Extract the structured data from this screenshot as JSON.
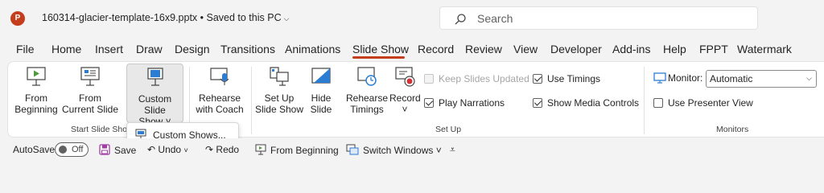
{
  "app": {
    "logo_letter": "P",
    "doc_title": "160314-glacier-template-16x9.pptx • Saved to this PC",
    "title_chevron": "⌵"
  },
  "search": {
    "placeholder": "Search"
  },
  "tabs": [
    "File",
    "Home",
    "Insert",
    "Draw",
    "Design",
    "Transitions",
    "Animations",
    "Slide Show",
    "Record",
    "Review",
    "View",
    "Developer",
    "Add-ins",
    "Help",
    "FPPT",
    "Watermark"
  ],
  "active_tab": "Slide Show",
  "ribbon": {
    "start_group": {
      "label": "Start Slide Show",
      "from_beginning": [
        "From",
        "Beginning"
      ],
      "from_current": [
        "From",
        "Current Slide"
      ],
      "custom_show": [
        "Custom Slide",
        "Show ˅"
      ]
    },
    "rehearse_coach": [
      "Rehearse",
      "with Coach"
    ],
    "setup_group": {
      "label": "Set Up",
      "set_up_show": [
        "Set Up",
        "Slide Show"
      ],
      "hide_slide": [
        "Hide",
        "Slide"
      ],
      "rehearse_timings": [
        "Rehearse",
        "Timings"
      ],
      "record": [
        "Record",
        "˅"
      ],
      "keep_slides_updated": "Keep Slides Updated",
      "play_narrations": "Play Narrations",
      "use_timings": "Use Timings",
      "show_media_controls": "Show Media Controls"
    },
    "monitors_group": {
      "label": "Monitors",
      "monitor_label": "Monitor:",
      "monitor_value": "Automatic",
      "use_presenter_view": "Use Presenter View"
    }
  },
  "popup": {
    "custom_shows": "Custom Shows..."
  },
  "qat": {
    "autosave": "AutoSave",
    "autosave_state": "Off",
    "save": "Save",
    "undo": "Undo",
    "redo": "Redo",
    "from_beginning": "From Beginning",
    "switch_windows": "Switch Windows ˅",
    "customize": "⩡"
  },
  "colors": {
    "accent": "#c43e1c",
    "monitor_blue": "#2b7cd3"
  }
}
